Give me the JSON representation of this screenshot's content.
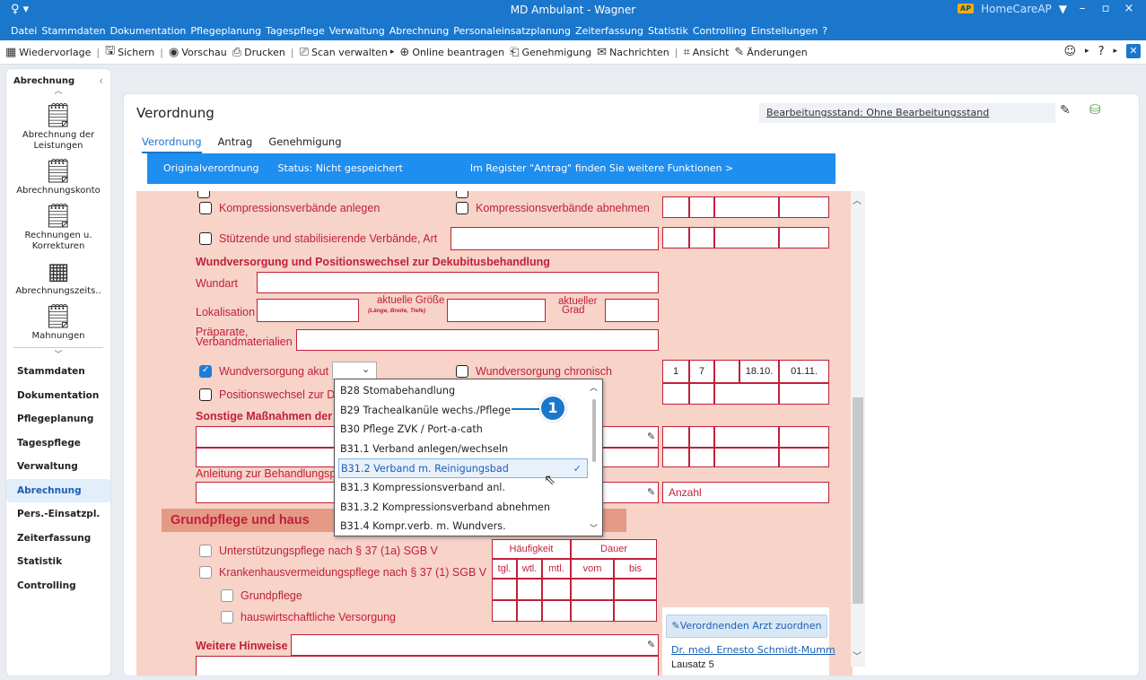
{
  "window": {
    "title": "MD Ambulant - Wagner",
    "brand_badge": "AP",
    "brand": "HomeCareAP"
  },
  "menu": [
    "Datei",
    "Stammdaten",
    "Dokumentation",
    "Pflegeplanung",
    "Tagespflege",
    "Verwaltung",
    "Abrechnung",
    "Personaleinsatzplanung",
    "Zeiterfassung",
    "Statistik",
    "Controlling",
    "Einstellungen",
    "?"
  ],
  "toolbar": {
    "wiedervorlage": "Wiedervorlage",
    "sichern": "Sichern",
    "vorschau": "Vorschau",
    "drucken": "Drucken",
    "scan": "Scan verwalten",
    "online": "Online beantragen",
    "genehmigung": "Genehmigung",
    "nachrichten": "Nachrichten",
    "ansicht": "Ansicht",
    "aenderungen": "Änderungen"
  },
  "sidebar": {
    "header": "Abrechnung",
    "tools": [
      {
        "label": "Abrechnung der Leistungen",
        "icon": "billing-icon"
      },
      {
        "label": "Abrechnungskonto",
        "icon": "account-icon"
      },
      {
        "label": "Rechnungen u. Korrekturen",
        "icon": "invoice-icon"
      },
      {
        "label": "Abrechnungszeits..",
        "icon": "calendar-icon"
      },
      {
        "label": "Mahnungen",
        "icon": "reminder-icon"
      }
    ],
    "nav": [
      "Stammdaten",
      "Dokumentation",
      "Pflegeplanung",
      "Tagespflege",
      "Verwaltung",
      "Abrechnung",
      "Pers.-Einsatzpl.",
      "Zeiterfassung",
      "Statistik",
      "Controlling"
    ]
  },
  "main": {
    "title": "Verordnung",
    "bearbeitungsstand": "Bearbeitungsstand:  Ohne Bearbeitungsstand",
    "tabs": [
      "Verordnung",
      "Antrag",
      "Genehmigung"
    ],
    "infobar": {
      "original": "Originalverordnung",
      "status": "Status: Nicht gespeichert",
      "hint": "Im Register \"Antrag\" finden Sie weitere Funktionen >"
    }
  },
  "form": {
    "kompr_anlegen": "Kompressionsverbände anlegen",
    "kompr_abnehmen": "Kompressionsverbände abnehmen",
    "stuetzende": "Stützende und stabilisierende Verbände, Art",
    "wund_header": "Wundversorgung und Positionswechsel zur Dekubitusbehandlung",
    "wundart": "Wundart",
    "lokalisation": "Lokalisation",
    "groesse": "aktuelle Größe",
    "groesse_sub": "(Länge, Breite, Tiefe)",
    "grad1": "aktueller",
    "grad2": "Grad",
    "praep1": "Präparate,",
    "praep2": "Verbandmaterialien",
    "wund_akut": "Wundversorgung akut",
    "wund_chron": "Wundversorgung chronisch",
    "pos_wechsel": "Positionswechsel zur D",
    "sonstige": "Sonstige Maßnahmen der",
    "anleitung": "Anleitung zur Behandlungsp",
    "anzahl": "Anzahl",
    "grundpflege_hdr": "Grundpflege und haus",
    "unterstuetzung": "Unterstützungspflege nach § 37 (1a) SGB V",
    "krankenhaus": "Krankenhausvermeidungspflege nach § 37 (1) SGB V",
    "grundpflege": "Grundpflege",
    "hauswirt": "hauswirtschaftliche Versorgung",
    "haeufigkeit": "Häufigkeit",
    "dauer": "Dauer",
    "tgl": "tgl.",
    "wtl": "wtl.",
    "mtl": "mtl.",
    "vom": "vom",
    "bis": "bis",
    "weitere": "Weitere Hinweise",
    "row_values": [
      "1",
      "7",
      "18.10.",
      "01.11."
    ],
    "assign_btn": "Verordnenden Arzt zuordnen",
    "doctor": "Dr. med. Ernesto Schmidt-Mumm",
    "street_partial": "Lausatz   5"
  },
  "dropdown": {
    "items": [
      "B28  Stomabehandlung",
      "B29  Trachealkanüle wechs./Pflege",
      "B30  Pflege ZVK / Port-a-cath",
      "B31.1  Verband anlegen/wechseln",
      "B31.2  Verband m. Reinigungsbad",
      "B31.3  Kompressionsverband anl.",
      "B31.3.2  Kompressionsverband abnehmen",
      "B31.4  Kompr.verb. m. Wundvers."
    ],
    "selected_index": 4
  },
  "callout": "1"
}
